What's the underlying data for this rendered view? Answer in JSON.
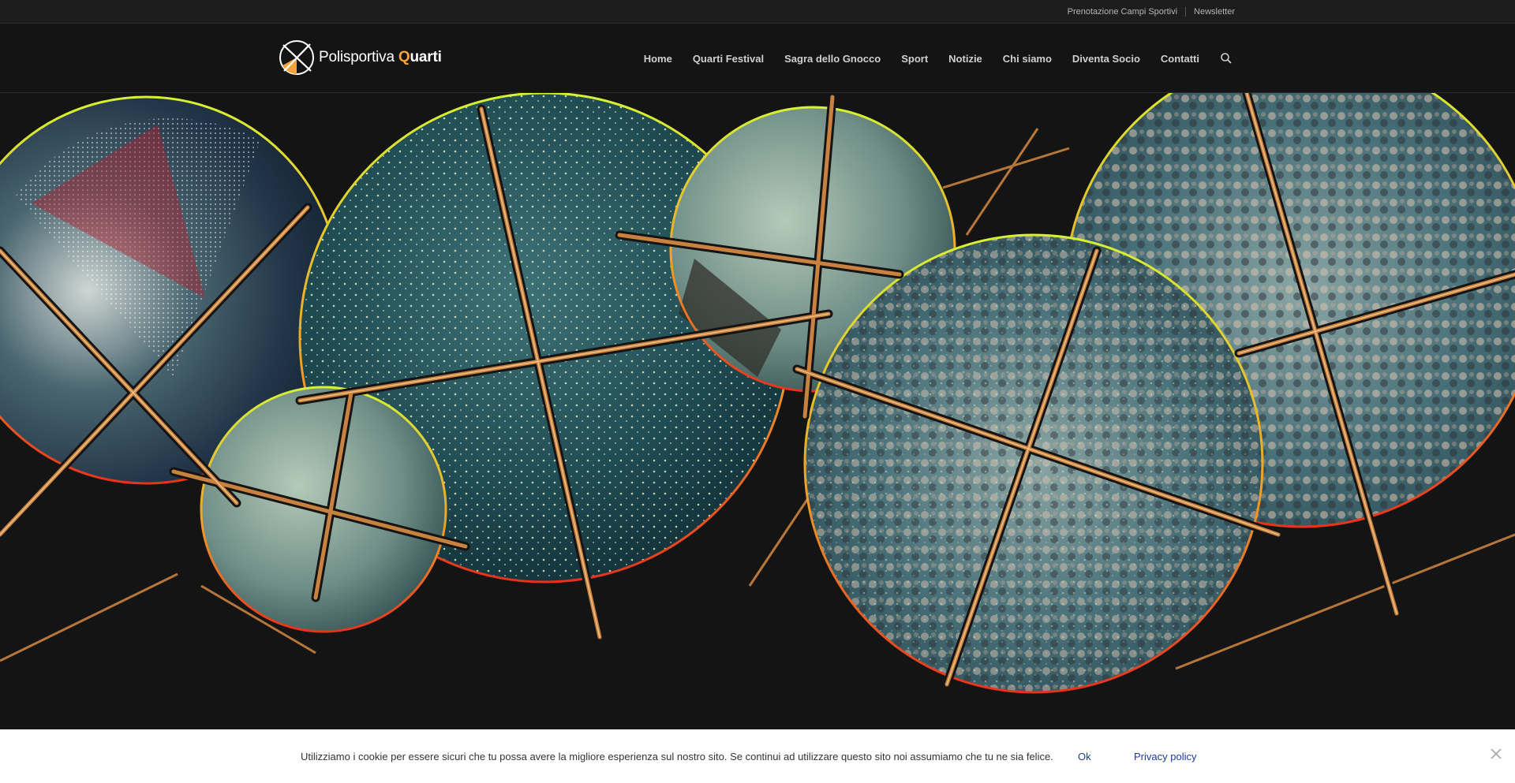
{
  "topbar": {
    "links": [
      "Prenotazione Campi Sportivi",
      "Newsletter"
    ]
  },
  "header": {
    "logo": {
      "prefix": "olisportiva",
      "p_letter": "P",
      "q_letter": "Q",
      "suffix": "uarti"
    },
    "nav": [
      "Home",
      "Quarti Festival",
      "Sagra dello Gnocco",
      "Sport",
      "Notizie",
      "Chi siamo",
      "Diventa Socio",
      "Contatti"
    ],
    "search_icon": "search-icon"
  },
  "hero": {
    "image": "collage of circular concert photographs with crossing orange sticks",
    "colors": {
      "rim_top": "#d6f233",
      "rim_bottom": "#e8321c",
      "sticks": "#c8813f",
      "photo_teal": "#1f4a52"
    }
  },
  "cookie_bar": {
    "text": "Utilizziamo i cookie per essere sicuri che tu possa avere la migliore esperienza sul nostro sito. Se continui ad utilizzare questo sito noi assumiamo che tu ne sia felice.",
    "ok": "Ok",
    "policy": "Privacy policy",
    "close_icon": "close-icon"
  },
  "colors": {
    "background": "#141414",
    "topbar": "#1d1d1d",
    "accent_orange": "#f7a23a",
    "link_blue": "#1a3b9a"
  }
}
